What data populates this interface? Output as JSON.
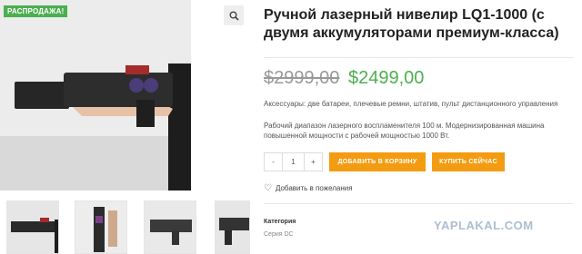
{
  "gallery": {
    "sale_badge": "РАСПРОДАЖА!",
    "zoom_icon": "search-icon",
    "thumbnails": [
      "thumb-1",
      "thumb-2",
      "thumb-3",
      "thumb-4"
    ]
  },
  "product": {
    "title": "Ручной лазерный нивелир LQ1-1000 (с двумя аккумуляторами премиум-класса)",
    "old_price": "$2999,00",
    "new_price": "$2499,00",
    "accessories": "Аксессуары: две батареи, плечевые ремни, штатив, пульт дистанционного управления",
    "description": "Рабочий диапазон лазерного воспламенителя 100 м. Модернизированная машина повышенной мощности с рабочей мощностью 1000 Вт.",
    "quantity": {
      "minus": "-",
      "value": "1",
      "plus": "+"
    },
    "add_to_cart": "ДОБАВИТЬ В КОРЗИНУ",
    "buy_now": "КУПИТЬ СЕЙЧАС",
    "wishlist": "Добавить в пожелания",
    "category_label": "Категория",
    "category_value": "Серия DC"
  },
  "watermark": "YAPLAKAL.COM",
  "colors": {
    "accent_green": "#4caf50",
    "button_orange": "#f39c12"
  }
}
